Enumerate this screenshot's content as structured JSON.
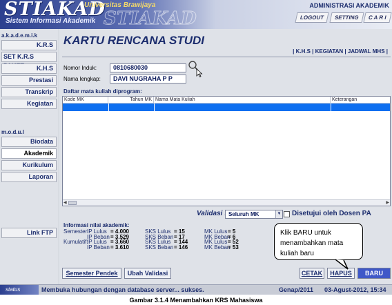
{
  "header": {
    "logo": "STIAKAD",
    "university": "Universitas Brawijaya",
    "subtitle": "Sistem Informasi Akademik",
    "admin_label": "ADMINISTRASI AKADEMIK",
    "nav": [
      "LOGOUT",
      "SETTING",
      "C A R I"
    ]
  },
  "sidebar": {
    "section1": "a.k.a.d.e.m.i.k",
    "items1": [
      "K.R.S",
      "SET K.R.S PAKET",
      "K.H.S",
      "Prestasi",
      "Transkrip",
      "Kegiatan"
    ],
    "section2": "m.o.d.u.l",
    "items2": [
      "Biodata",
      "Akademik",
      "Kurikulum",
      "Laporan"
    ],
    "link_ftp": "Link FTP"
  },
  "main": {
    "title": "KARTU RENCANA STUDI",
    "links": "| K.H.S | KEGIATAN | JADWAL MHS |",
    "nomor_label": "Nomor Induk:",
    "nomor_value": "0810680030",
    "nama_label": "Nama lengkap:",
    "nama_value": "DAVI NUGRAHA P  P",
    "list_title": "Daftar mata kuliah diprogram:",
    "columns": [
      "Kode MK",
      "Tahun MK",
      "Nama Mata Kuliah",
      "Keterangan"
    ],
    "validasi_label": "Validasi :",
    "validasi_value": "Seluruh MK",
    "disetujui_label": "Disetujui oleh Dosen PA",
    "info_title": "Informasi nilai akademik:",
    "semester_label": "Semester:",
    "kumulatif_label": "Kumulatif:",
    "ip_lulus_label": "IP Lulus",
    "ip_beban_label": "IP Beban",
    "sks_lulus_label": "SKS Lulus",
    "sks_beban_label": "SKS Beban",
    "mk_lulus_label": "MK Lulus",
    "mk_beban_label": "MK Beban",
    "sem_ip_lulus": "= 4.000",
    "sem_ip_beban": "= 3.529",
    "sem_sks_lulus": "= 15",
    "sem_sks_beban": "= 17",
    "sem_mk_lulus": "= 5",
    "sem_mk_beban": "= 6",
    "kum_ip_lulus": "= 3.660",
    "kum_ip_beban": "= 3.610",
    "kum_sks_lulus": "= 144",
    "kum_sks_beban": "= 146",
    "kum_mk_lulus": "= 52",
    "kum_mk_beban": "= 53",
    "btn_semester": "Semester Pendek",
    "btn_ubah": "Ubah Validasi",
    "btn_cetak": "CETAK",
    "btn_hapus": "HAPUS",
    "btn_baru": "BARU"
  },
  "status": {
    "tag": "status",
    "message": "Membuka hubungan dengan database server... sukses.",
    "period": "Genap/2011",
    "datetime": "03-Agust-2012, 15:34"
  },
  "callout": "Klik BARU untuk menambahkan mata kuliah baru",
  "caption": "Gambar 3.1.4 Menambahkan KRS Mahasiswa"
}
